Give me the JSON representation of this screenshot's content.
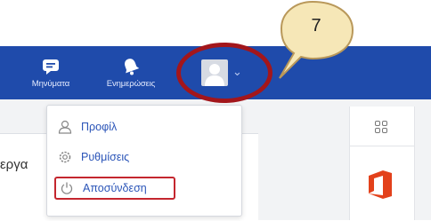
{
  "nav": {
    "messages_label": "Μηνύματα",
    "notifications_label": "Ενημερώσεις"
  },
  "page": {
    "panel_text": "εργα"
  },
  "dropdown": {
    "items": [
      {
        "label": "Προφίλ",
        "icon": "user-icon"
      },
      {
        "label": "Ρυθμίσεις",
        "icon": "gear-icon"
      },
      {
        "label": "Αποσύνδεση",
        "icon": "power-icon"
      }
    ]
  },
  "annotation": {
    "step_number": "7"
  },
  "colors": {
    "navbar": "#1f4bab",
    "menu_text": "#2b55b8",
    "highlight": "#c4262e",
    "ring": "#a3161b",
    "callout_fill": "#f6e7b7",
    "office": "#e3411b"
  }
}
